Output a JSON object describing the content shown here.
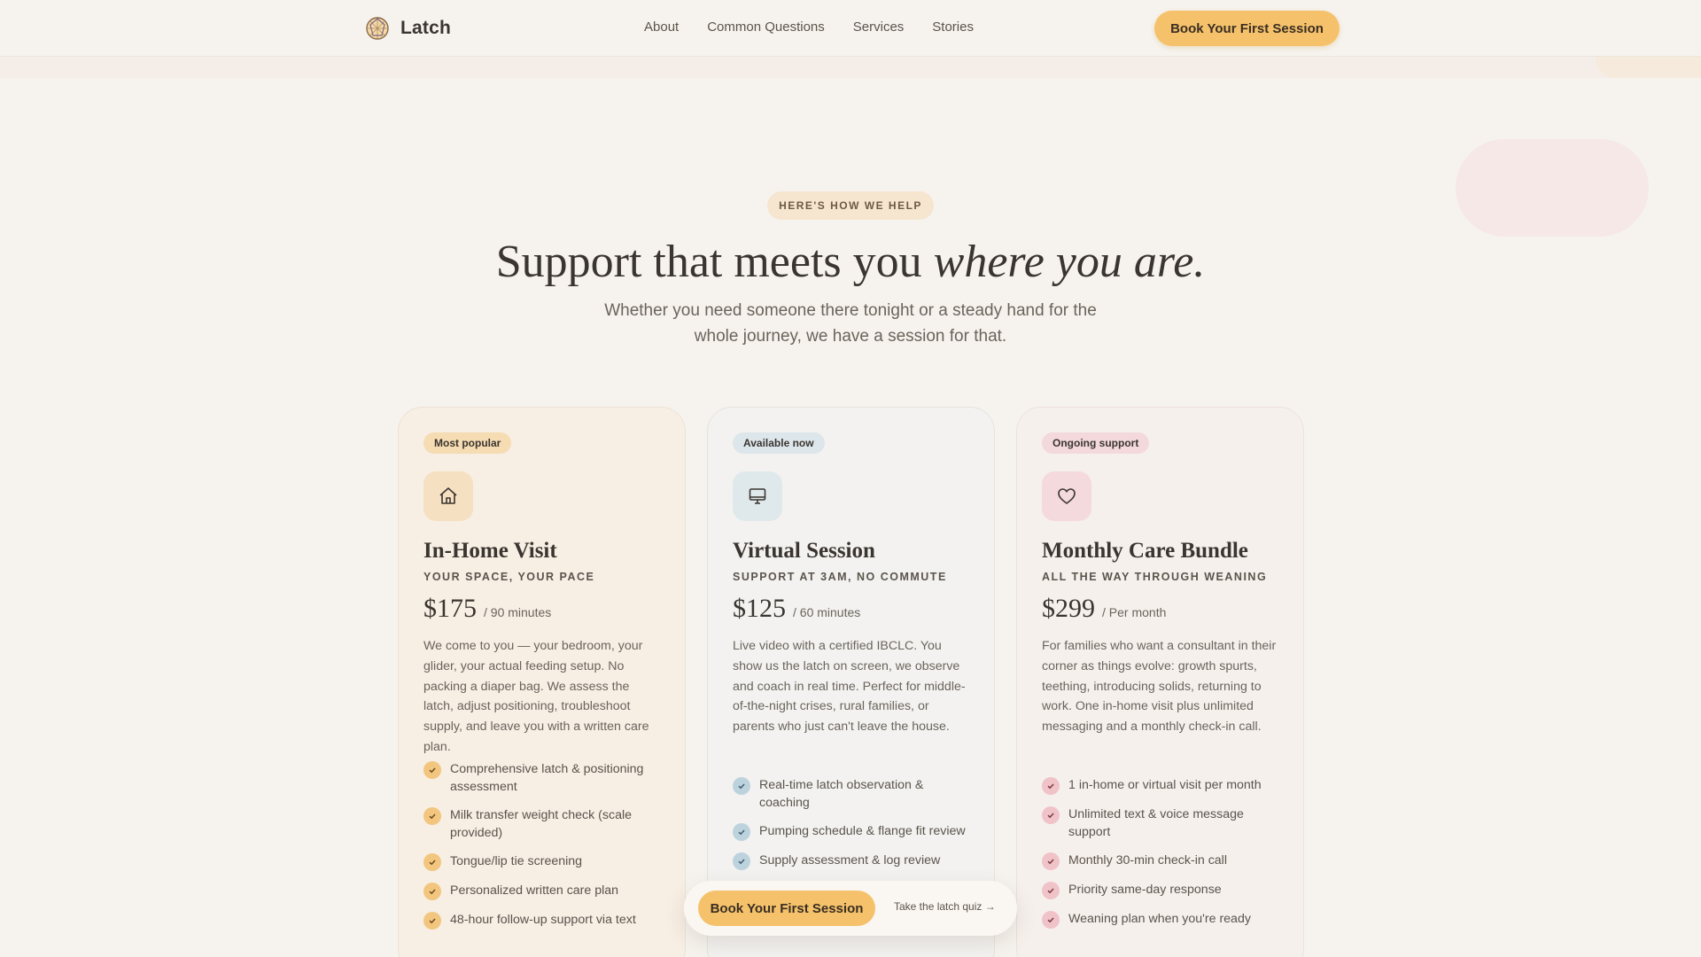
{
  "header": {
    "brand": "Latch",
    "nav": [
      "About",
      "Common Questions",
      "Services",
      "Stories"
    ],
    "cta": "Book Your First Session"
  },
  "hero": {
    "eyebrow": "HERE'S HOW WE HELP",
    "headline_plain": "Support that meets you ",
    "headline_italic": "where you are.",
    "subhead": "Whether you need someone there tonight or a steady hand for the whole journey, we have a session for that."
  },
  "cards": [
    {
      "badge": "Most popular",
      "icon": "home-icon",
      "title": "In-Home Visit",
      "tagline": "YOUR SPACE, YOUR PACE",
      "price": "$175",
      "per": "/ 90 minutes",
      "description": "We come to you — your bedroom, your glider, your actual feeding setup. No packing a diaper bag. We assess the latch, adjust positioning, troubleshoot supply, and leave you with a written care plan.",
      "features": [
        "Comprehensive latch & positioning assessment",
        "Milk transfer weight check (scale provided)",
        "Tongue/lip tie screening",
        "Personalized written care plan",
        "48-hour follow-up support via text"
      ]
    },
    {
      "badge": "Available now",
      "icon": "monitor-icon",
      "title": "Virtual Session",
      "tagline": "SUPPORT AT 3AM, NO COMMUTE",
      "price": "$125",
      "per": "/ 60 minutes",
      "description": "Live video with a certified IBCLC. You show us the latch on screen, we observe and coach in real time. Perfect for middle-of-the-night crises, rural families, or parents who just can't leave the house.",
      "features": [
        "Real-time latch observation & coaching",
        "Pumping schedule & flange fit review",
        "Supply assessment & log review"
      ]
    },
    {
      "badge": "Ongoing support",
      "icon": "heart-icon",
      "title": "Monthly Care Bundle",
      "tagline": "ALL THE WAY THROUGH WEANING",
      "price": "$299",
      "per": "/ Per month",
      "description": "For families who want a consultant in their corner as things evolve: growth spurts, teething, introducing solids, returning to work. One in-home visit plus unlimited messaging and a monthly check-in call.",
      "features": [
        "1 in-home or virtual visit per month",
        "Unlimited text & voice message support",
        "Monthly 30-min check-in call",
        "Priority same-day response",
        "Weaning plan when you're ready"
      ]
    }
  ],
  "floating": {
    "cta": "Book Your First Session",
    "link": "Take the latch quiz →"
  },
  "colors": {
    "background": "#f6f3ee",
    "accent": "#f5c26b",
    "text": "#3a3530"
  }
}
